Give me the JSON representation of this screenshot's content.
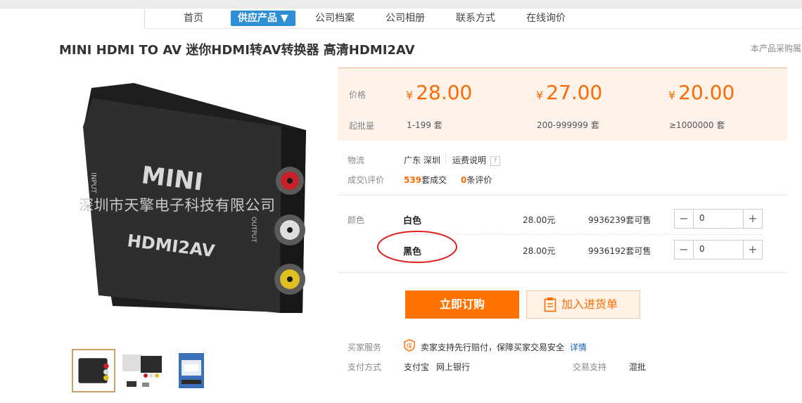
{
  "nav": {
    "items": [
      {
        "label": "首页"
      },
      {
        "label": "供应产品 ▼"
      },
      {
        "label": "公司档案"
      },
      {
        "label": "公司相册"
      },
      {
        "label": "联系方式"
      },
      {
        "label": "在线询价"
      }
    ]
  },
  "product": {
    "title": "MINI HDMI TO AV 迷你HDMI转AV转换器 高清HDMI2AV",
    "right_note": "本产品采购属",
    "watermark": "深圳市天擎电子科技有限公司",
    "image_labels": {
      "brand": "MINI",
      "model": "HDMI2AV",
      "input": "INPUT",
      "output": "OUTPUT"
    }
  },
  "pricing": {
    "price_label": "价格",
    "moq_label": "起批量",
    "currency": "¥",
    "tiers": [
      {
        "price": "28.00",
        "range": "1-199 套"
      },
      {
        "price": "27.00",
        "range": "200-999999 套"
      },
      {
        "price": "20.00",
        "range": "≥1000000 套"
      }
    ]
  },
  "logistics": {
    "label": "物流",
    "location": "广东 深圳",
    "freight": "运费说明",
    "help": "?"
  },
  "deals": {
    "label": "成交\\评价",
    "count": "539",
    "count_suffix": "套成交",
    "reviews": "0",
    "reviews_suffix": "条评价"
  },
  "colors": {
    "label": "颜色",
    "options": [
      {
        "name": "白色",
        "price": "28.00元",
        "stock": "9936239套可售",
        "qty": "0"
      },
      {
        "name": "黑色",
        "price": "28.00元",
        "stock": "9936192套可售",
        "qty": "0"
      }
    ]
  },
  "actions": {
    "buy_now": "立即订购",
    "add_cart": "加入进货单"
  },
  "service": {
    "label": "买家服务",
    "badge": "保",
    "text": "卖家支持先行赔付，保障买家交易安全",
    "link": "详情"
  },
  "payment": {
    "label": "支付方式",
    "methods": [
      "支付宝",
      "网上银行"
    ],
    "trade_label": "交易支持",
    "trade_value": "混批"
  },
  "theme": {
    "accent": "#ff7200",
    "price_color": "#ff6a00",
    "nav_active": "#2d8fd5",
    "highlight_ring": "#e02020"
  }
}
